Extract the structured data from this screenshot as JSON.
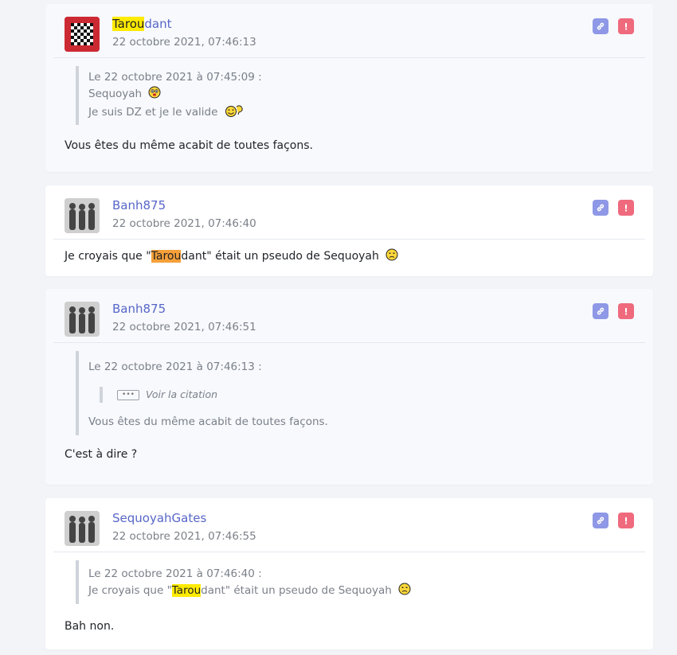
{
  "posts": [
    {
      "author_highlight": "Tarou",
      "author_rest": "dant",
      "date": "22 octobre 2021, 07:46:13",
      "quote": {
        "header": "Le 22 octobre 2021 à 07:45:09 :",
        "line1": "Sequoyah",
        "line2": "Je suis DZ et je le valide"
      },
      "text": "Vous êtes du même acabit de toutes façons."
    },
    {
      "author": "Banh875",
      "date": "22 octobre 2021, 07:46:40",
      "text_before": "Je croyais que \"",
      "text_highlight": "Tarou",
      "text_after": "dant\" était un pseudo de Sequoyah"
    },
    {
      "author": "Banh875",
      "date": "22 octobre 2021, 07:46:51",
      "quote": {
        "header": "Le 22 octobre 2021 à 07:46:13 :",
        "inner_dots": "•••",
        "inner_label": "Voir la citation",
        "line": "Vous êtes du même acabit de toutes façons."
      },
      "text": "C'est à dire ?"
    },
    {
      "author": "SequoyahGates",
      "date": "22 octobre 2021, 07:46:55",
      "quote": {
        "header": "Le 22 octobre 2021 à 07:46:40 :",
        "before": "Je croyais que \"",
        "highlight": "Tarou",
        "after": "dant\" était un pseudo de Sequoyah"
      },
      "text": "Bah non."
    }
  ],
  "icons": {
    "link": "link-icon",
    "report": "alert-icon"
  },
  "colors": {
    "author": "#5866c8",
    "link_button": "#8e98e6",
    "report_button": "#ef6a7d",
    "highlight_yellow": "#ffeb00",
    "highlight_orange": "#f5a03a"
  }
}
